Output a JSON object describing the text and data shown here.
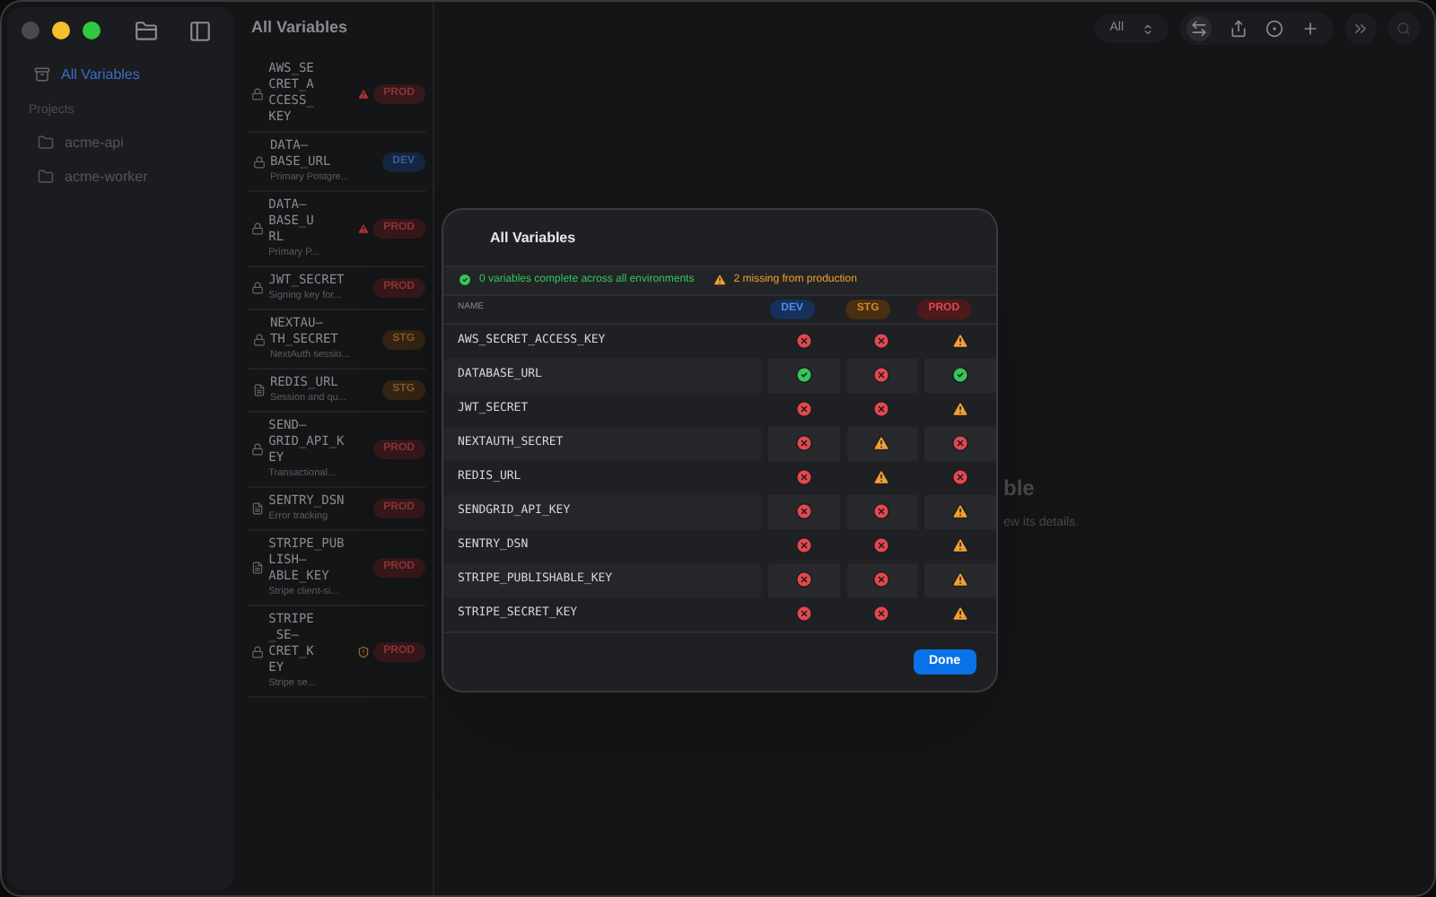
{
  "window": {
    "title": "All Variables"
  },
  "sidebar": {
    "items": [
      {
        "label": "All Variables",
        "selected": true
      }
    ],
    "section": "Projects",
    "projects": [
      {
        "label": "acme-api",
        "selected": false
      },
      {
        "label": "acme-worker",
        "selected": false
      }
    ]
  },
  "toolbar": {
    "filter": "All"
  },
  "variables": [
    {
      "name_lines": [
        "AWS_SE",
        "CRET_A",
        "CCESS_",
        "KEY"
      ],
      "kind": "secret",
      "alert": {
        "kind": "error"
      },
      "env": "PROD"
    },
    {
      "name_lines": [
        "DATA–",
        "BASE_URL"
      ],
      "description": "Primary Postgre...",
      "kind": "secret",
      "env": "DEV"
    },
    {
      "name_lines": [
        "DATA–",
        "BASE_U",
        "RL"
      ],
      "description": "Primary P...",
      "kind": "secret",
      "alert": {
        "kind": "error"
      },
      "env": "PROD"
    },
    {
      "name_lines": [
        "JWT_SECRET"
      ],
      "description": "Signing key for...",
      "kind": "secret",
      "env": "PROD"
    },
    {
      "name_lines": [
        "NEXTAU–",
        "TH_SECRET"
      ],
      "description": "NextAuth sessio...",
      "kind": "secret",
      "env": "STG"
    },
    {
      "name_lines": [
        "REDIS_URL"
      ],
      "description": "Session and qu...",
      "kind": "plain",
      "env": "STG"
    },
    {
      "name_lines": [
        "SEND–",
        "GRID_API_K",
        "EY"
      ],
      "description": "Transactional...",
      "kind": "secret",
      "env": "PROD"
    },
    {
      "name_lines": [
        "SENTRY_DSN"
      ],
      "description": "Error tracking",
      "kind": "plain",
      "env": "PROD"
    },
    {
      "name_lines": [
        "STRIPE_PUB",
        "LISH–",
        "ABLE_KEY"
      ],
      "description": "Stripe client-si...",
      "kind": "plain",
      "env": "PROD"
    },
    {
      "name_lines": [
        "STRIPE",
        "_SE–",
        "CRET_K",
        "EY"
      ],
      "description": "Stripe se...",
      "kind": "secret",
      "alert": {
        "kind": "pending"
      },
      "env": "PROD"
    }
  ],
  "empty_state": {
    "title": "ble",
    "hint": "ew its details."
  },
  "dialog": {
    "title": "All Variables",
    "complete": "0 variables complete across all environments",
    "missing": "2 missing from production",
    "columns": [
      "NAME",
      "DEV",
      "STG",
      "PROD"
    ],
    "rows": [
      {
        "name": "AWS_SECRET_ACCESS_KEY",
        "cells": [
          {
            "kind": "missing"
          },
          {
            "kind": "missing"
          },
          {
            "kind": "warning"
          }
        ]
      },
      {
        "name": "DATABASE_URL",
        "cells": [
          {
            "kind": "ok"
          },
          {
            "kind": "missing"
          },
          {
            "kind": "ok"
          }
        ]
      },
      {
        "name": "JWT_SECRET",
        "cells": [
          {
            "kind": "missing"
          },
          {
            "kind": "missing"
          },
          {
            "kind": "warning"
          }
        ]
      },
      {
        "name": "NEXTAUTH_SECRET",
        "cells": [
          {
            "kind": "missing"
          },
          {
            "kind": "warning"
          },
          {
            "kind": "missing"
          }
        ]
      },
      {
        "name": "REDIS_URL",
        "cells": [
          {
            "kind": "missing"
          },
          {
            "kind": "warning"
          },
          {
            "kind": "missing"
          }
        ]
      },
      {
        "name": "SENDGRID_API_KEY",
        "cells": [
          {
            "kind": "missing"
          },
          {
            "kind": "missing"
          },
          {
            "kind": "warning"
          }
        ]
      },
      {
        "name": "SENTRY_DSN",
        "cells": [
          {
            "kind": "missing"
          },
          {
            "kind": "missing"
          },
          {
            "kind": "warning"
          }
        ]
      },
      {
        "name": "STRIPE_PUBLISHABLE_KEY",
        "cells": [
          {
            "kind": "missing"
          },
          {
            "kind": "missing"
          },
          {
            "kind": "warning"
          }
        ]
      },
      {
        "name": "STRIPE_SECRET_KEY",
        "cells": [
          {
            "kind": "missing"
          },
          {
            "kind": "missing"
          },
          {
            "kind": "warning"
          }
        ]
      }
    ],
    "button": "Done"
  }
}
